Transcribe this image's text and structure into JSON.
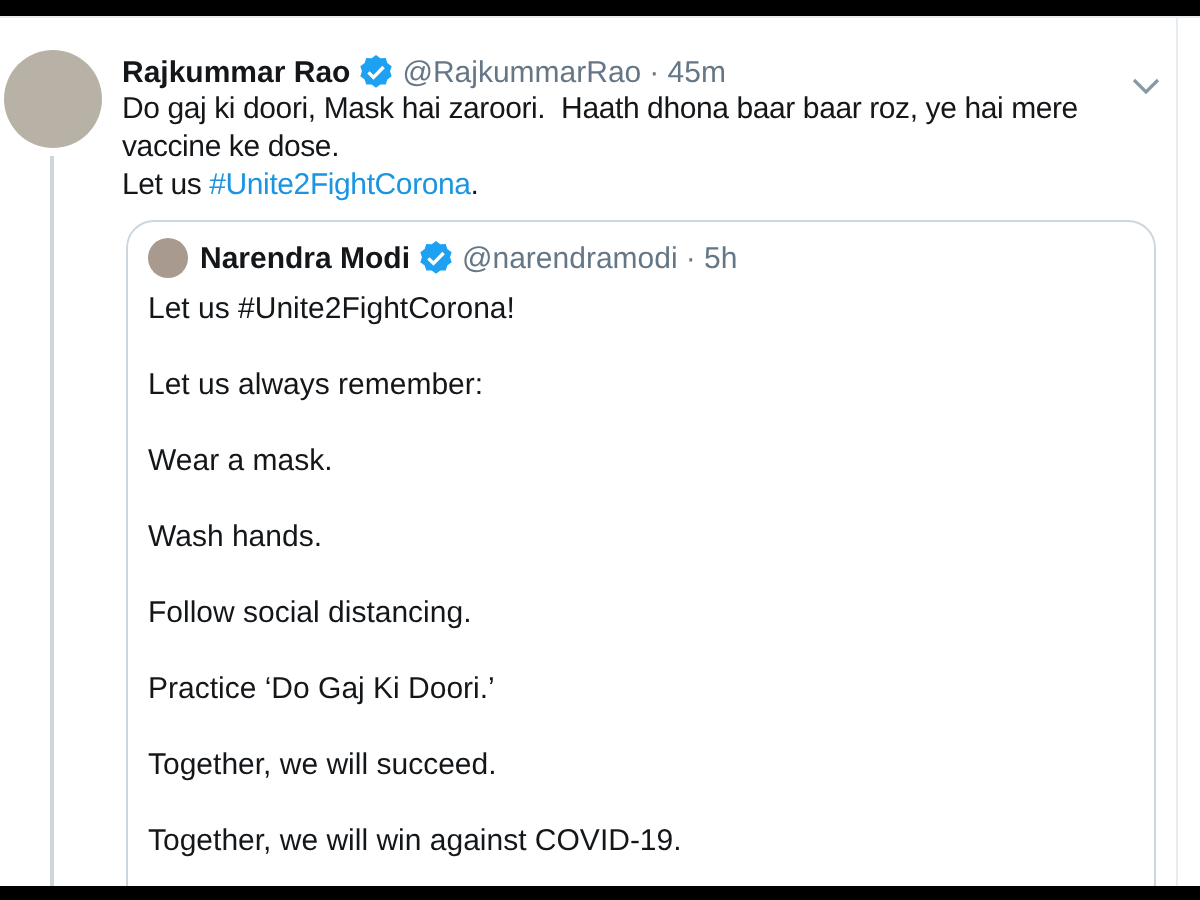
{
  "tweet": {
    "author": "Rajkummar Rao",
    "verified": true,
    "handle": "@RajkummarRao",
    "time": "· 45m",
    "body": [
      {
        "kind": "text",
        "text": "Do gaj ki doori, Mask hai zaroori.  Haath dhona baar baar roz, ye hai mere vaccine ke dose."
      },
      {
        "kind": "break"
      },
      {
        "kind": "text",
        "text": "Let us "
      },
      {
        "kind": "hashtag",
        "text": "#Unite2FightCorona"
      },
      {
        "kind": "text",
        "text": "."
      }
    ],
    "quoted": {
      "author": "Narendra Modi",
      "verified": true,
      "handle": "@narendramodi",
      "time": "· 5h",
      "paragraphs": [
        "Let us #Unite2FightCorona!",
        "Let us always remember:",
        "Wear a mask.",
        "Wash hands.",
        "Follow social distancing.",
        "Practice ‘Do Gaj Ki Doori.’",
        "Together, we will succeed.",
        "Together, we will win against COVID-19."
      ]
    }
  }
}
